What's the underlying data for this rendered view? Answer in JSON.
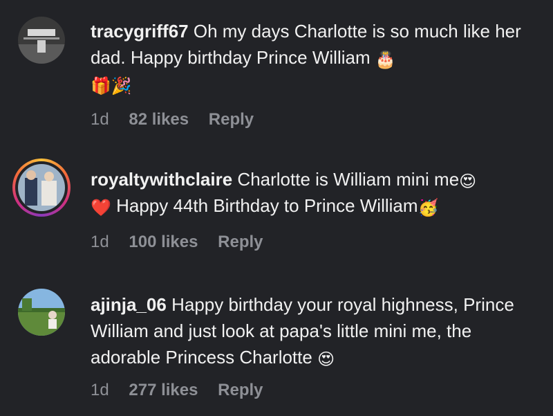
{
  "comments": [
    {
      "username": "tracygriff67",
      "text": " Oh my days Charlotte is so much like her dad. Happy birthday Prince William ",
      "emoji_after": "🎂",
      "line2_emojis": "🎁🎉",
      "time": "1d",
      "likes": "82 likes",
      "reply": "Reply",
      "avatar_icon": "photo-avatar-icon"
    },
    {
      "username": "royaltywithclaire",
      "text": " Charlotte is William mini me",
      "emoji_after": "😍",
      "line2_prefix_emoji": "❤️",
      "line2_text": " Happy 44th Birthday to Prince William",
      "line2_emoji": "🥳",
      "time": "1d",
      "likes": "100 likes",
      "reply": "Reply",
      "avatar_icon": "photo-avatar-icon"
    },
    {
      "username": "ajinja_06",
      "text": " Happy birthday your royal highness, Prince William and just look at papa's little mini me, the adorable Princess Charlotte ",
      "emoji_after": "😍",
      "time": "1d",
      "likes": "277 likes",
      "reply": "Reply",
      "avatar_icon": "photo-avatar-icon"
    }
  ],
  "colors": {
    "background": "#222327",
    "text": "#f1f1f1",
    "meta": "#8e9096"
  }
}
